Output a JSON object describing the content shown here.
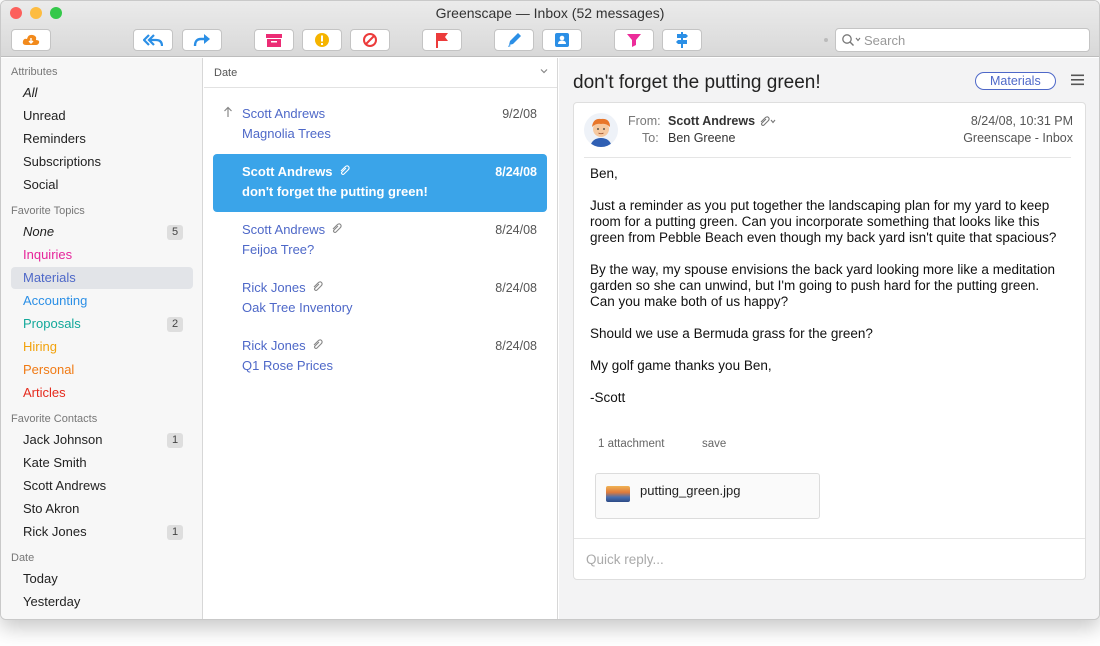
{
  "window": {
    "title": "Greenscape — Inbox (52 messages)"
  },
  "colors": {
    "accent": "#3aa4e9",
    "link": "#4e68c8",
    "traffic_close": "#fc605c",
    "traffic_min": "#fdbc40",
    "traffic_max": "#34c84a"
  },
  "toolbar": {
    "buttons": [
      {
        "icon": "cloud-download-icon",
        "color": "#f28a1c"
      },
      {
        "icon": "reply-all-icon",
        "color": "#2b8fe6"
      },
      {
        "icon": "forward-icon",
        "color": "#2b8fe6"
      },
      {
        "icon": "archive-icon",
        "color": "#ec2c75"
      },
      {
        "icon": "warning-icon",
        "color": "#f5b400"
      },
      {
        "icon": "block-icon",
        "color": "#ec3b3b"
      },
      {
        "icon": "flag-icon",
        "color": "#ec3b3b"
      },
      {
        "icon": "pencil-icon",
        "color": "#2b8fe6"
      },
      {
        "icon": "contact-card-icon",
        "color": "#2b8fe6"
      },
      {
        "icon": "funnel-icon",
        "color": "#ec2c9a"
      },
      {
        "icon": "signpost-icon",
        "color": "#2b8fe6"
      }
    ],
    "search_placeholder": "Search"
  },
  "sidebar": {
    "sections": [
      {
        "title": "Attributes",
        "items": [
          {
            "label": "All",
            "italic": true
          },
          {
            "label": "Unread"
          },
          {
            "label": "Reminders"
          },
          {
            "label": "Subscriptions"
          },
          {
            "label": "Social"
          }
        ]
      },
      {
        "title": "Favorite Topics",
        "items": [
          {
            "label": "None",
            "italic": true,
            "badge": "5"
          },
          {
            "label": "Inquiries",
            "color": "#e6249a"
          },
          {
            "label": "Materials",
            "color": "#4e68c8",
            "selected": true
          },
          {
            "label": "Accounting",
            "color": "#2b8fe6"
          },
          {
            "label": "Proposals",
            "color": "#12a89a",
            "badge": "2"
          },
          {
            "label": "Hiring",
            "color": "#f2a20c"
          },
          {
            "label": "Personal",
            "color": "#f07a14"
          },
          {
            "label": "Articles",
            "color": "#e52b1e"
          }
        ]
      },
      {
        "title": "Favorite Contacts",
        "items": [
          {
            "label": "Jack Johnson",
            "badge": "1"
          },
          {
            "label": "Kate Smith"
          },
          {
            "label": "Scott Andrews"
          },
          {
            "label": "Sto Akron"
          },
          {
            "label": "Rick Jones",
            "badge": "1"
          }
        ]
      },
      {
        "title": "Date",
        "items": [
          {
            "label": "Today"
          },
          {
            "label": "Yesterday"
          }
        ]
      }
    ]
  },
  "message_list": {
    "sort_label": "Date",
    "messages": [
      {
        "from": "Scott Andrews",
        "subject": "Magnolia Trees",
        "date": "9/2/08",
        "replied": true,
        "attachment": false,
        "selected": false
      },
      {
        "from": "Scott Andrews",
        "subject": "don't forget the putting green!",
        "date": "8/24/08",
        "replied": false,
        "attachment": true,
        "selected": true
      },
      {
        "from": "Scott Andrews",
        "subject": "Feijoa Tree?",
        "date": "8/24/08",
        "replied": false,
        "attachment": true,
        "selected": false
      },
      {
        "from": "Rick Jones",
        "subject": "Oak Tree Inventory",
        "date": "8/24/08",
        "replied": false,
        "attachment": true,
        "selected": false
      },
      {
        "from": "Rick Jones",
        "subject": "Q1 Rose Prices",
        "date": "8/24/08",
        "replied": false,
        "attachment": true,
        "selected": false
      }
    ]
  },
  "reader": {
    "subject": "don't forget the putting green!",
    "topic_tag": "Materials",
    "from_label": "From:",
    "to_label": "To:",
    "from": "Scott Andrews",
    "to": "Ben Greene",
    "datetime": "8/24/08, 10:31 PM",
    "mailbox": "Greenscape - Inbox",
    "body": [
      [
        "Ben,"
      ],
      [
        "Just a reminder as you put together the landscaping plan for my yard to keep",
        "room for a putting green. Can you incorporate something that looks like this",
        "green from Pebble Beach even though my back yard isn't quite that spacious?"
      ],
      [
        "By the way, my spouse envisions the back yard looking more like a meditation",
        "garden so she can unwind, but I'm going to push hard for the putting green.",
        "Can you make both of us happy?"
      ],
      [
        "Should we use a Bermuda grass for the green?"
      ],
      [
        "My golf game thanks you Ben,"
      ],
      [
        "-Scott"
      ]
    ],
    "attachment_count": "1 attachment",
    "save_label": "save",
    "attachment_name": "putting_green.jpg",
    "quick_reply_placeholder": "Quick reply..."
  }
}
